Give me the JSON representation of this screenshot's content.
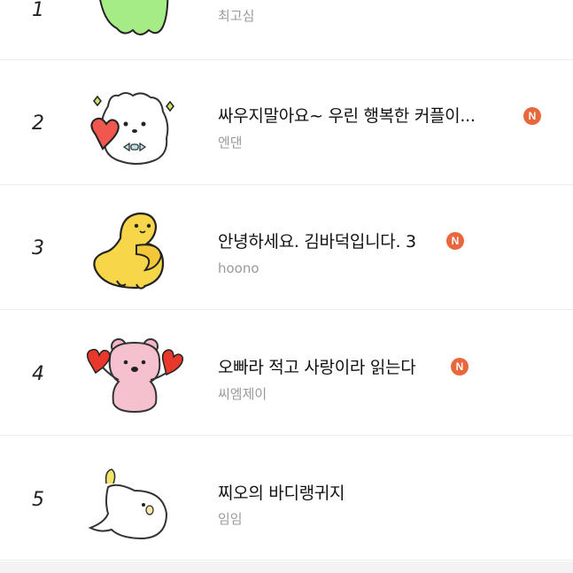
{
  "items": [
    {
      "rank": "1",
      "title": "",
      "author": "최고심",
      "badge": ""
    },
    {
      "rank": "2",
      "title": "싸우지말아요~ 우린 행복한 커플이...",
      "author": "엔댄",
      "badge": "N"
    },
    {
      "rank": "3",
      "title": "안녕하세요. 김바덕입니다. 3",
      "author": "hoono",
      "badge": "N"
    },
    {
      "rank": "4",
      "title": "오빠라 적고 사랑이라 읽는다",
      "author": "씨엠제이",
      "badge": "N"
    },
    {
      "rank": "5",
      "title": "찌오의 바디랭귀지",
      "author": "임임",
      "badge": ""
    }
  ]
}
